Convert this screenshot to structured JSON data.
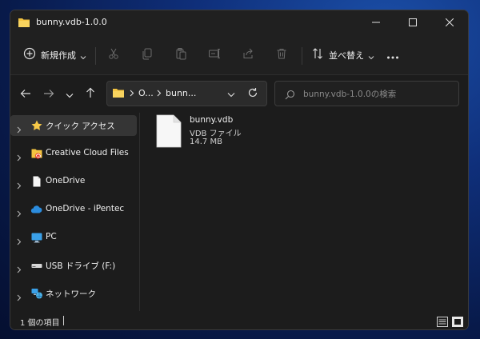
{
  "window": {
    "title": "bunny.vdb-1.0.0"
  },
  "toolbar": {
    "new_label": "新規作成",
    "sort_label": "並べ替え"
  },
  "address": {
    "crumb1": "O...",
    "crumb2": "bunn...",
    "search_placeholder": "bunny.vdb-1.0.0の検索"
  },
  "sidebar": {
    "items": [
      {
        "label": "クイック アクセス",
        "icon": "star-icon"
      },
      {
        "label": "Creative Cloud Files",
        "icon": "creative-cloud-icon"
      },
      {
        "label": "OneDrive",
        "icon": "document-icon"
      },
      {
        "label": "OneDrive - iPentec",
        "icon": "cloud-icon"
      },
      {
        "label": "PC",
        "icon": "monitor-icon"
      },
      {
        "label": "USB ドライブ (F:)",
        "icon": "usb-drive-icon"
      },
      {
        "label": "ネットワーク",
        "icon": "network-icon"
      }
    ]
  },
  "files": [
    {
      "name": "bunny.vdb",
      "type": "VDB ファイル",
      "size": "14.7 MB"
    }
  ],
  "status": {
    "item_count": "1 個の項目"
  },
  "colors": {
    "folder_yellow": "#f4c441",
    "accent_blue": "#2b8cde",
    "star_gold": "#f7c948"
  }
}
